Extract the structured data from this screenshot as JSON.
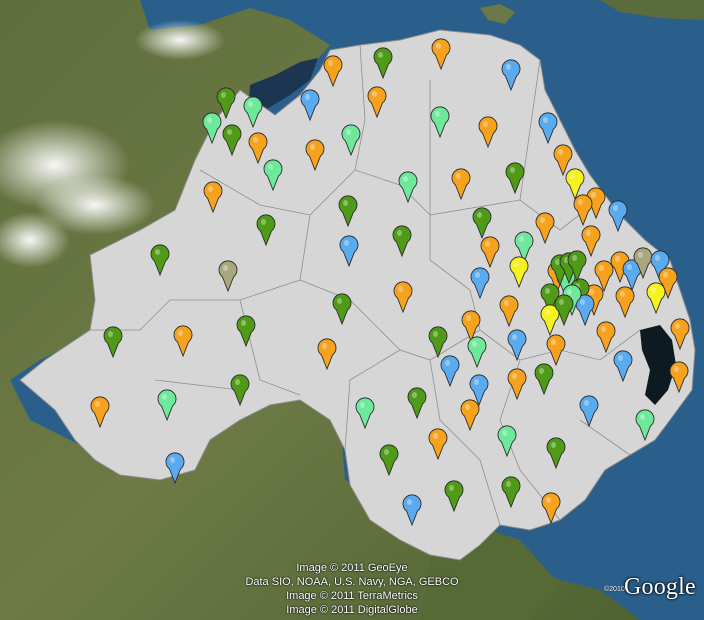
{
  "colors": {
    "sea": "#2a5f8c",
    "land_overlay": "#d6d6d6",
    "orange": "#f7a21c",
    "green": "#4f9a17",
    "lightgreen": "#6ee89a",
    "blue": "#5aaaf0",
    "yellow": "#f5f21c",
    "olive": "#a9a77e"
  },
  "markers": [
    [
      "orange",
      441,
      54
    ],
    [
      "orange",
      333,
      71
    ],
    [
      "green",
      383,
      63
    ],
    [
      "blue",
      511,
      75
    ],
    [
      "orange",
      377,
      102
    ],
    [
      "blue",
      310,
      105
    ],
    [
      "green",
      226,
      103
    ],
    [
      "lightgreen",
      253,
      112
    ],
    [
      "lightgreen",
      212,
      128
    ],
    [
      "green",
      232,
      140
    ],
    [
      "orange",
      258,
      148
    ],
    [
      "lightgreen",
      351,
      140
    ],
    [
      "lightgreen",
      440,
      122
    ],
    [
      "orange",
      488,
      132
    ],
    [
      "blue",
      548,
      128
    ],
    [
      "orange",
      315,
      155
    ],
    [
      "lightgreen",
      273,
      175
    ],
    [
      "orange",
      213,
      197
    ],
    [
      "orange",
      461,
      184
    ],
    [
      "green",
      515,
      178
    ],
    [
      "orange",
      563,
      160
    ],
    [
      "yellow",
      575,
      184
    ],
    [
      "orange",
      596,
      203
    ],
    [
      "blue",
      618,
      216
    ],
    [
      "orange",
      583,
      210
    ],
    [
      "lightgreen",
      408,
      187
    ],
    [
      "green",
      348,
      211
    ],
    [
      "green",
      266,
      230
    ],
    [
      "green",
      482,
      223
    ],
    [
      "orange",
      545,
      228
    ],
    [
      "orange",
      591,
      241
    ],
    [
      "blue",
      349,
      251
    ],
    [
      "green",
      402,
      241
    ],
    [
      "orange",
      490,
      252
    ],
    [
      "lightgreen",
      524,
      247
    ],
    [
      "green",
      160,
      260
    ],
    [
      "olive",
      228,
      276
    ],
    [
      "orange",
      403,
      297
    ],
    [
      "green",
      342,
      309
    ],
    [
      "blue",
      480,
      283
    ],
    [
      "yellow",
      519,
      272
    ],
    [
      "orange",
      557,
      277
    ],
    [
      "orange",
      604,
      276
    ],
    [
      "orange",
      620,
      267
    ],
    [
      "blue",
      632,
      275
    ],
    [
      "olive",
      643,
      263
    ],
    [
      "blue",
      660,
      266
    ],
    [
      "orange",
      668,
      283
    ],
    [
      "yellow",
      656,
      298
    ],
    [
      "orange",
      625,
      302
    ],
    [
      "orange",
      594,
      300
    ],
    [
      "green",
      550,
      299
    ],
    [
      "lightgreen",
      566,
      283
    ],
    [
      "green",
      580,
      294
    ],
    [
      "blue",
      585,
      310
    ],
    [
      "yellow",
      550,
      320
    ],
    [
      "orange",
      509,
      311
    ],
    [
      "orange",
      471,
      326
    ],
    [
      "green",
      246,
      331
    ],
    [
      "orange",
      183,
      341
    ],
    [
      "green",
      113,
      342
    ],
    [
      "green",
      438,
      342
    ],
    [
      "lightgreen",
      477,
      352
    ],
    [
      "blue",
      517,
      345
    ],
    [
      "orange",
      556,
      350
    ],
    [
      "orange",
      606,
      337
    ],
    [
      "orange",
      680,
      334
    ],
    [
      "blue",
      623,
      366
    ],
    [
      "orange",
      327,
      354
    ],
    [
      "orange",
      679,
      377
    ],
    [
      "blue",
      450,
      371
    ],
    [
      "blue",
      479,
      390
    ],
    [
      "orange",
      517,
      384
    ],
    [
      "green",
      544,
      379
    ],
    [
      "green",
      240,
      390
    ],
    [
      "lightgreen",
      167,
      405
    ],
    [
      "orange",
      100,
      412
    ],
    [
      "green",
      417,
      403
    ],
    [
      "lightgreen",
      365,
      413
    ],
    [
      "orange",
      470,
      415
    ],
    [
      "blue",
      589,
      411
    ],
    [
      "lightgreen",
      645,
      425
    ],
    [
      "lightgreen",
      507,
      441
    ],
    [
      "orange",
      438,
      444
    ],
    [
      "green",
      556,
      453
    ],
    [
      "blue",
      175,
      468
    ],
    [
      "green",
      389,
      460
    ],
    [
      "green",
      454,
      496
    ],
    [
      "green",
      511,
      492
    ],
    [
      "orange",
      551,
      508
    ],
    [
      "blue",
      412,
      510
    ],
    [
      "green",
      560,
      270
    ],
    [
      "green",
      569,
      268
    ],
    [
      "green",
      577,
      266
    ],
    [
      "lightgreen",
      572,
      300
    ],
    [
      "green",
      564,
      310
    ]
  ],
  "attribution": [
    "Image © 2011 GeoEye",
    "Data SIO, NOAA, U.S. Navy, NGA, GEBCO",
    "Image © 2011 TerraMetrics",
    "Image © 2011 DigitalGlobe"
  ],
  "logo": {
    "copyright": "©2010",
    "wordmark": "Google"
  }
}
